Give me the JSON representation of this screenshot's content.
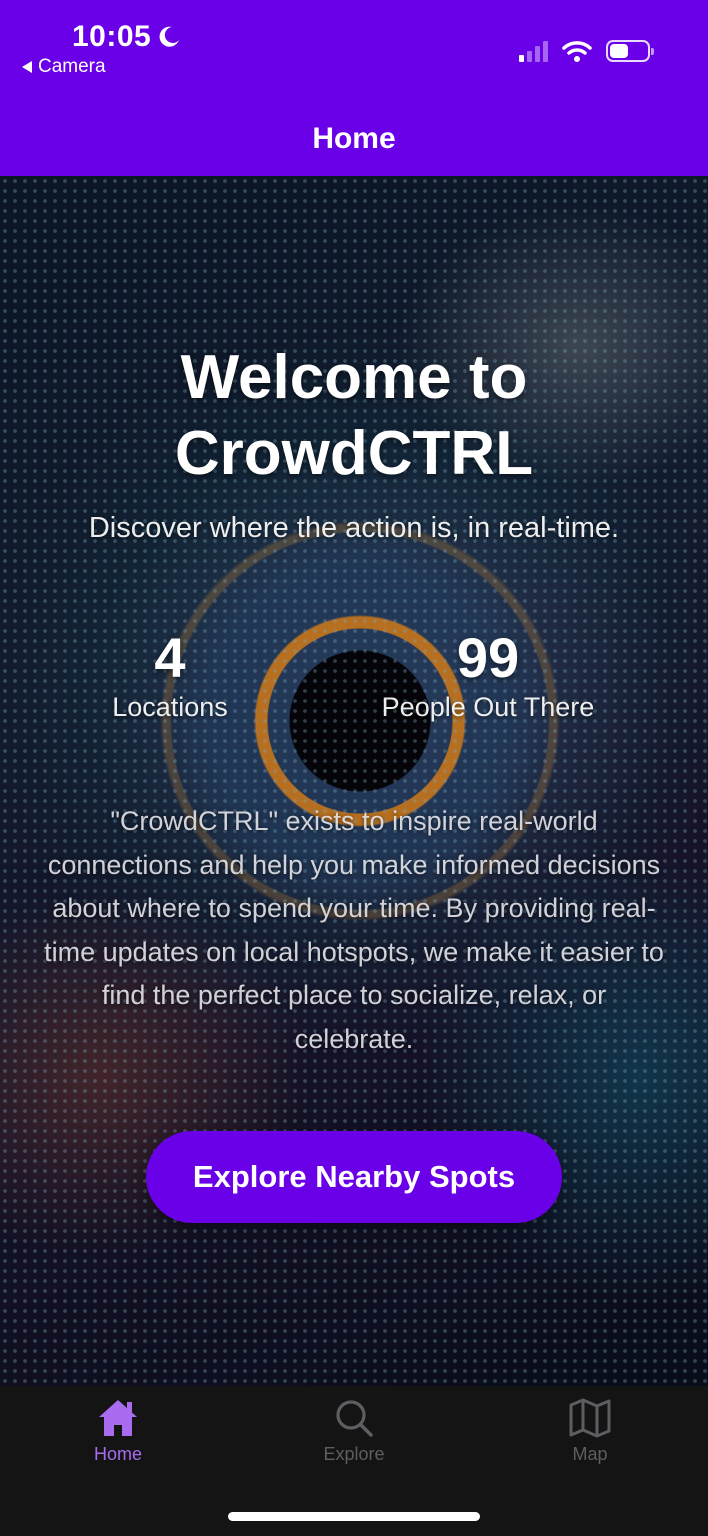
{
  "status_bar": {
    "time": "10:05",
    "back_app": "Camera",
    "moon_icon": "moon-icon",
    "signal_icon": "cellular-signal-icon",
    "wifi_icon": "wifi-icon",
    "battery_icon": "battery-icon",
    "battery_level": 0.5
  },
  "header": {
    "title": "Home"
  },
  "hero": {
    "welcome_line1": "Welcome to",
    "welcome_line2": "CrowdCTRL",
    "subtitle": "Discover where the action is, in real-time.",
    "stats": [
      {
        "value": "4",
        "label": "Locations"
      },
      {
        "value": "99",
        "label": "People Out There"
      }
    ],
    "mission": "\"CrowdCTRL\" exists to inspire real-world connections and help you make informed decisions about where to spend your time. By providing real-time updates on local hotspots, we make it easier to find the perfect place to socialize, relax, or celebrate.",
    "cta_label": "Explore Nearby Spots"
  },
  "tabbar": {
    "tabs": [
      {
        "label": "Home",
        "icon": "home-icon",
        "active": true
      },
      {
        "label": "Explore",
        "icon": "search-icon",
        "active": false
      },
      {
        "label": "Map",
        "icon": "map-icon",
        "active": false
      }
    ]
  },
  "colors": {
    "brand": "#6a00e8",
    "tab_active": "#a96bf0",
    "tab_inactive": "#5e5e62",
    "tabbar_bg": "#141414"
  }
}
